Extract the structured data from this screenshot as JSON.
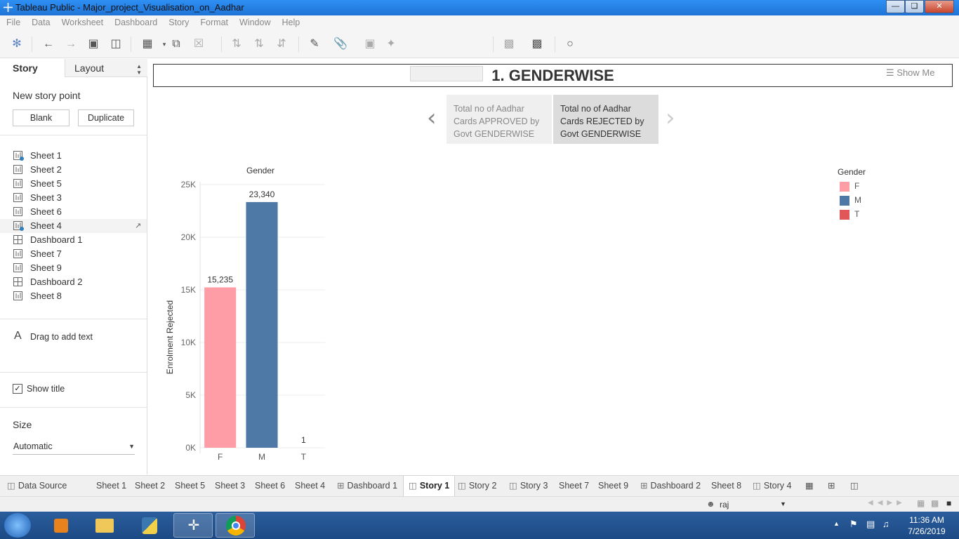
{
  "window": {
    "title": "Tableau Public - Major_project_Visualisation_on_Aadhar"
  },
  "menu": [
    "File",
    "Data",
    "Worksheet",
    "Dashboard",
    "Story",
    "Format",
    "Window",
    "Help"
  ],
  "toolbar": {
    "show_me": "Show Me"
  },
  "left_pane": {
    "tab_story": "Story",
    "tab_layout": "Layout",
    "new_story_point": "New story point",
    "blank_button": "Blank",
    "duplicate_button": "Duplicate",
    "sheets": [
      {
        "label": "Sheet 1",
        "type": "sheet",
        "used": true
      },
      {
        "label": "Sheet 2",
        "type": "sheet",
        "used": false
      },
      {
        "label": "Sheet 5",
        "type": "sheet",
        "used": false
      },
      {
        "label": "Sheet 3",
        "type": "sheet",
        "used": false
      },
      {
        "label": "Sheet 6",
        "type": "sheet",
        "used": false
      },
      {
        "label": "Sheet 4",
        "type": "sheet",
        "used": true
      },
      {
        "label": "Dashboard 1",
        "type": "dashboard",
        "used": false
      },
      {
        "label": "Sheet 7",
        "type": "sheet",
        "used": false
      },
      {
        "label": "Sheet 9",
        "type": "sheet",
        "used": false
      },
      {
        "label": "Dashboard 2",
        "type": "dashboard",
        "used": false
      },
      {
        "label": "Sheet 8",
        "type": "sheet",
        "used": false
      }
    ],
    "drag_text": "Drag to add text",
    "show_title_label": "Show title",
    "show_title_checked": true,
    "size_heading": "Size",
    "size_value": "Automatic"
  },
  "story": {
    "title": "1. GENDERWISE",
    "points": [
      {
        "text_lines": [
          "Total no of Aadhar",
          "Cards  APPROVED by",
          "Govt GENDERWISE"
        ],
        "selected": false
      },
      {
        "text_lines": [
          "Total no of Aadhar",
          "Cards  REJECTED by",
          "Govt GENDERWISE"
        ],
        "selected": true
      }
    ]
  },
  "chart_data": {
    "type": "bar",
    "title": "Gender",
    "ylabel": "Enrolment Rejected",
    "xlabel": "",
    "categories": [
      "F",
      "M",
      "T"
    ],
    "values": [
      15235,
      23340,
      1
    ],
    "value_labels": [
      "15,235",
      "23,340",
      "1"
    ],
    "colors": [
      "#ff9da7",
      "#4e79a7",
      "#e15759"
    ],
    "ylim": [
      0,
      25000
    ],
    "y_ticks": [
      0,
      5000,
      10000,
      15000,
      20000,
      25000
    ],
    "y_tick_labels": [
      "0K",
      "5K",
      "10K",
      "15K",
      "20K",
      "25K"
    ],
    "grid": true,
    "legend": {
      "title": "Gender",
      "position": "top-right",
      "items": [
        {
          "label": "F",
          "color": "#ff9da7"
        },
        {
          "label": "M",
          "color": "#4e79a7"
        },
        {
          "label": "T",
          "color": "#e15759"
        }
      ]
    }
  },
  "bottom_tabs": [
    {
      "label": "Data Source",
      "icon": "data-source-icon",
      "active": false
    },
    {
      "label": "Sheet 1",
      "icon": "",
      "active": false
    },
    {
      "label": "Sheet 2",
      "icon": "",
      "active": false
    },
    {
      "label": "Sheet 5",
      "icon": "",
      "active": false
    },
    {
      "label": "Sheet 3",
      "icon": "",
      "active": false
    },
    {
      "label": "Sheet 6",
      "icon": "",
      "active": false
    },
    {
      "label": "Sheet 4",
      "icon": "",
      "active": false
    },
    {
      "label": "Dashboard 1",
      "icon": "dashboard-icon",
      "active": false
    },
    {
      "label": "Story 1",
      "icon": "story-icon",
      "active": true
    },
    {
      "label": "Story 2",
      "icon": "story-icon",
      "active": false
    },
    {
      "label": "Story 3",
      "icon": "story-icon",
      "active": false
    },
    {
      "label": "Sheet 7",
      "icon": "",
      "active": false
    },
    {
      "label": "Sheet 9",
      "icon": "",
      "active": false
    },
    {
      "label": "Dashboard 2",
      "icon": "dashboard-icon",
      "active": false
    },
    {
      "label": "Sheet 8",
      "icon": "",
      "active": false
    },
    {
      "label": "Story 4",
      "icon": "story-icon",
      "active": false
    }
  ],
  "status": {
    "user": "raj"
  },
  "taskbar": {
    "time": "11:36 AM",
    "date": "7/26/2019"
  }
}
